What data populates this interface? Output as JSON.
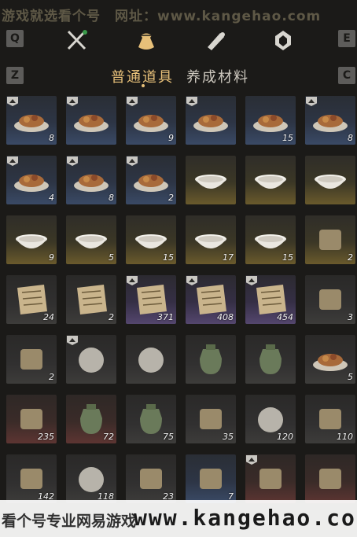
{
  "watermark": {
    "top_text": "游戏就选看个号　网址：www.kangehao.com",
    "bottom_text": "看个号专业网易游戏",
    "bottom_url": "www.kangehao.co"
  },
  "topbar": {
    "key_left": "Q",
    "key_right": "E",
    "tabs": [
      {
        "icon": "crossed-weapons-icon"
      },
      {
        "icon": "pouch-icon",
        "active": true
      },
      {
        "icon": "scroll-icon"
      },
      {
        "icon": "gem-emblem-icon"
      }
    ]
  },
  "subbar": {
    "key_left": "Z",
    "key_right": "C",
    "tab_common": "普通道具",
    "tab_materials": "养成材料"
  },
  "colors": {
    "accent_gold": "#e7c079",
    "rarity_blue": "#3a4a66",
    "rarity_yellow": "#6a5a2c",
    "rarity_purple": "#54466e",
    "rarity_red": "#5d3532"
  },
  "items": [
    {
      "icon": "dumpling-plate-icon",
      "count": "8",
      "rarity": "blue",
      "badge": true
    },
    {
      "icon": "meat-bowl-icon",
      "count": "",
      "rarity": "blue",
      "badge": true
    },
    {
      "icon": "stew-pot-icon",
      "count": "9",
      "rarity": "blue",
      "badge": true
    },
    {
      "icon": "soup-bowl-icon",
      "count": "",
      "rarity": "blue",
      "badge": true
    },
    {
      "icon": "meatball-plate-icon",
      "count": "15",
      "rarity": "blue",
      "badge": false
    },
    {
      "icon": "fried-dish-icon",
      "count": "8",
      "rarity": "blue",
      "badge": true
    },
    {
      "icon": "pastry-board-icon",
      "count": "4",
      "rarity": "blue",
      "badge": true
    },
    {
      "icon": "layered-cake-icon",
      "count": "8",
      "rarity": "blue",
      "badge": true
    },
    {
      "icon": "steamed-bun-icon",
      "count": "2",
      "rarity": "blue",
      "badge": true
    },
    {
      "icon": "white-bowl-icon",
      "count": "",
      "rarity": "yellow",
      "badge": false
    },
    {
      "icon": "flower-bowl-icon",
      "count": "",
      "rarity": "yellow",
      "badge": false
    },
    {
      "icon": "painted-bowl-icon",
      "count": "",
      "rarity": "yellow",
      "badge": false
    },
    {
      "icon": "rooster-bowl-icon",
      "count": "9",
      "rarity": "yellow",
      "badge": false
    },
    {
      "icon": "porcelain-bowl-icon",
      "count": "5",
      "rarity": "yellow",
      "badge": false
    },
    {
      "icon": "lidded-bowl-icon",
      "count": "15",
      "rarity": "yellow",
      "badge": false
    },
    {
      "icon": "shallow-plate-icon",
      "count": "17",
      "rarity": "yellow",
      "badge": false
    },
    {
      "icon": "blue-rim-bowl-icon",
      "count": "15",
      "rarity": "yellow",
      "badge": false
    },
    {
      "icon": "jade-seal-icon",
      "count": "2",
      "rarity": "yellow",
      "badge": false
    },
    {
      "icon": "bamboo-book-icon",
      "count": "24",
      "rarity": "gray",
      "badge": false
    },
    {
      "icon": "paper-sheet-icon",
      "count": "2",
      "rarity": "gray",
      "badge": false
    },
    {
      "icon": "letter-icon",
      "count": "371",
      "rarity": "purple",
      "badge": true
    },
    {
      "icon": "note-icon",
      "count": "408",
      "rarity": "purple",
      "badge": true
    },
    {
      "icon": "manuscript-icon",
      "count": "454",
      "rarity": "purple",
      "badge": true
    },
    {
      "icon": "hanging-lantern-icon",
      "count": "3",
      "rarity": "gray",
      "badge": false
    },
    {
      "icon": "carpenter-square-icon",
      "count": "2",
      "rarity": "gray",
      "badge": false
    },
    {
      "icon": "egg-icon",
      "count": "",
      "rarity": "gray",
      "badge": true
    },
    {
      "icon": "stone-icon",
      "count": "",
      "rarity": "gray",
      "badge": false
    },
    {
      "icon": "green-teapot-icon",
      "count": "",
      "rarity": "gray",
      "badge": false
    },
    {
      "icon": "white-teapot-icon",
      "count": "",
      "rarity": "gray",
      "badge": false
    },
    {
      "icon": "biscuits-icon",
      "count": "5",
      "rarity": "gray",
      "badge": false
    },
    {
      "icon": "plum-blossom-icon",
      "count": "235",
      "rarity": "red",
      "badge": false
    },
    {
      "icon": "wine-jar-icon",
      "count": "72",
      "rarity": "red",
      "badge": false
    },
    {
      "icon": "bronze-vessel-icon",
      "count": "75",
      "rarity": "gray",
      "badge": false
    },
    {
      "icon": "gold-ingot-icon",
      "count": "35",
      "rarity": "gray",
      "badge": false
    },
    {
      "icon": "copper-coin-icon",
      "count": "120",
      "rarity": "gray",
      "badge": false
    },
    {
      "icon": "tea-powder-icon",
      "count": "110",
      "rarity": "gray",
      "badge": false
    },
    {
      "icon": "earthworm-icon",
      "count": "142",
      "rarity": "gray",
      "badge": false
    },
    {
      "icon": "cloth-sack-icon",
      "count": "118",
      "rarity": "gray",
      "badge": false
    },
    {
      "icon": "arrow-icon",
      "count": "23",
      "rarity": "gray",
      "badge": false
    },
    {
      "icon": "spark-crystal-icon",
      "count": "7",
      "rarity": "blue",
      "badge": false
    },
    {
      "icon": "crossed-chopsticks-icon",
      "count": "",
      "rarity": "red",
      "badge": true
    },
    {
      "icon": "red-envelope-icon",
      "count": "",
      "rarity": "red",
      "badge": false
    }
  ]
}
